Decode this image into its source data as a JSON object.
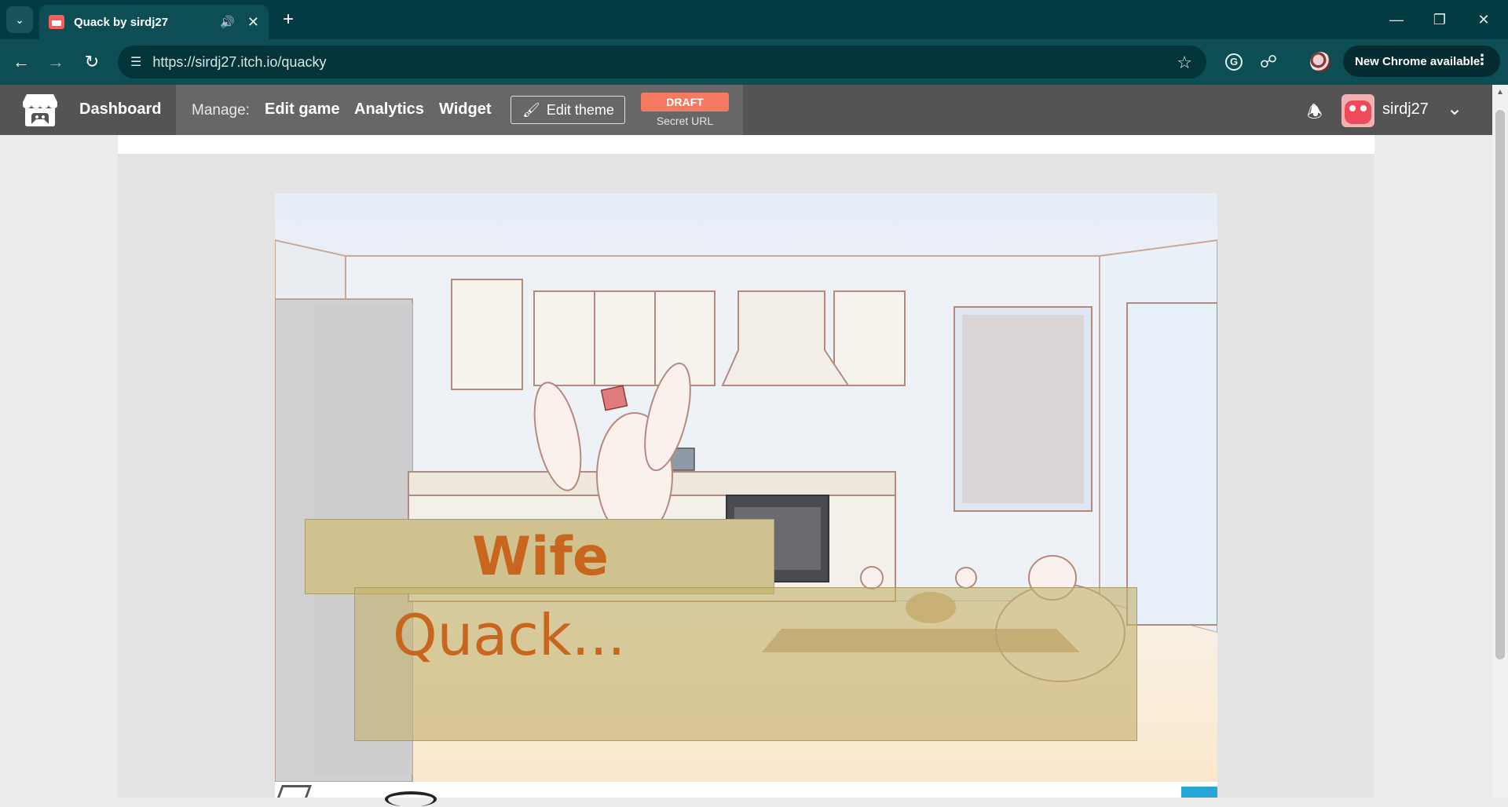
{
  "browser": {
    "tab_title": "Quack by sirdj27",
    "tab_audio_icon": "speaker-icon",
    "url": "https://sirdj27.itch.io/quacky",
    "update_button": "New Chrome available"
  },
  "itch_header": {
    "dashboard": "Dashboard",
    "manage_label": "Manage:",
    "edit_game": "Edit game",
    "analytics": "Analytics",
    "widget": "Widget",
    "edit_theme": "Edit theme",
    "draft_badge": "DRAFT",
    "secret_url": "Secret URL",
    "username": "sirdj27"
  },
  "game": {
    "speaker": "Wife",
    "dialog": "Quack...",
    "colors": {
      "name_box": "#cfc28e",
      "text": "#c8661d",
      "dialog_box": "#c4b26e"
    }
  },
  "colors": {
    "tab_bar": "#033b42",
    "toolbar": "#0d4e55",
    "itch_header": "#545454",
    "draft": "#f67a62"
  }
}
